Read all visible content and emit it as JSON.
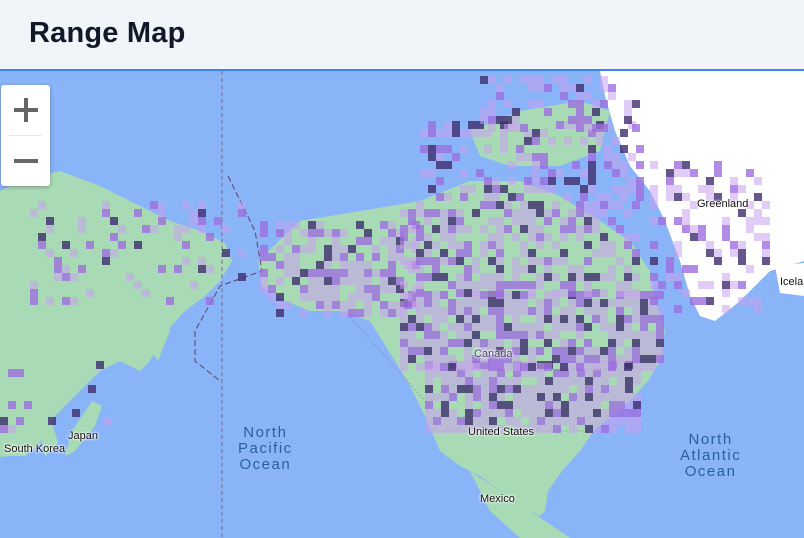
{
  "header": {
    "title": "Range Map"
  },
  "map": {
    "zoom_in_icon": "plus-icon",
    "zoom_out_icon": "minus-icon",
    "colors": {
      "water": "#8ab4f8",
      "land": "#a8dab5",
      "ice": "#ffffff",
      "range_light": "#c9a0f0",
      "range_mid": "#9e6ee0",
      "range_dark": "#3f2d6e"
    },
    "labels": {
      "greenland": "Greenland",
      "canada": "Canada",
      "united_states": "United States",
      "mexico": "Mexico",
      "japan": "Japan",
      "south_korea": "South Korea",
      "iceland": "Icela",
      "north_pacific_ocean": "North\nPacific\nOcean",
      "north_atlantic_ocean": "North\nAtlantic\nOcean"
    }
  }
}
